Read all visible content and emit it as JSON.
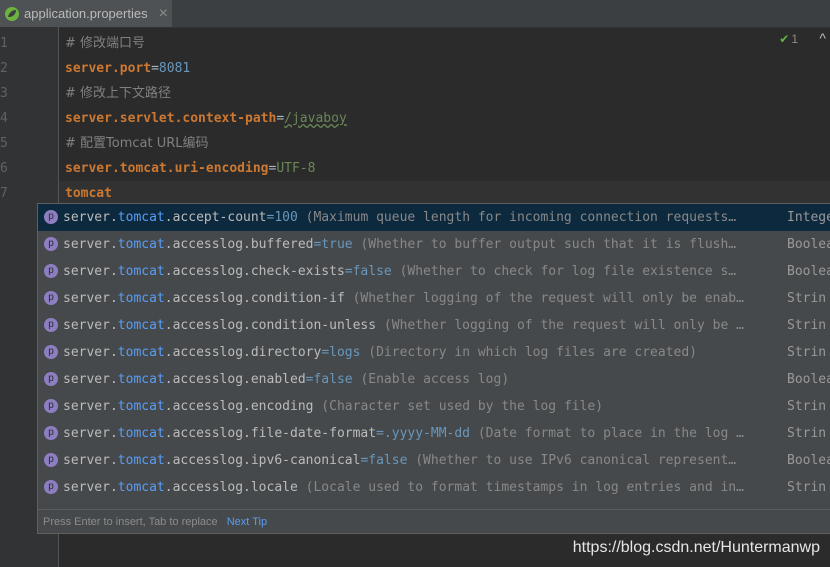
{
  "tab": {
    "label": "application.properties",
    "close": "×"
  },
  "gutter": {
    "line_numbers": [
      "1",
      "2",
      "3",
      "4",
      "5",
      "6",
      "7"
    ]
  },
  "status": {
    "check": "✔",
    "count": "1",
    "chevron": "^"
  },
  "editor": {
    "lines": [
      {
        "kind": "comment",
        "text": "# 修改端口号"
      },
      {
        "kind": "kv",
        "key": "server.port",
        "eq": "=",
        "value": "8081",
        "value_kind": "num"
      },
      {
        "kind": "comment",
        "text": "# 修改上下文路径"
      },
      {
        "kind": "kv",
        "key": "server.servlet.context-path",
        "eq": "=",
        "value": "/javaboy",
        "value_kind": "str"
      },
      {
        "kind": "comment",
        "text": "# 配置Tomcat URL编码"
      },
      {
        "kind": "kv",
        "key": "server.tomcat.uri-encoding",
        "eq": "=",
        "value": "UTF-8",
        "value_kind": "str"
      },
      {
        "kind": "key",
        "key": "tomcat"
      }
    ]
  },
  "completion": {
    "items": [
      {
        "prefix": "server.",
        "highlight": "tomcat",
        "rest": ".accept-count",
        "default": "=100",
        "desc": " (Maximum queue length for incoming connection requests…",
        "type": "Intege",
        "selected": true
      },
      {
        "prefix": "server.",
        "highlight": "tomcat",
        "rest": ".accesslog.buffered",
        "default": "=true",
        "desc": " (Whether to buffer output such that it is flush…",
        "type": "Boolea"
      },
      {
        "prefix": "server.",
        "highlight": "tomcat",
        "rest": ".accesslog.check-exists",
        "default": "=false",
        "desc": " (Whether to check for log file existence s…",
        "type": "Boolea"
      },
      {
        "prefix": "server.",
        "highlight": "tomcat",
        "rest": ".accesslog.condition-if",
        "default": "",
        "desc": " (Whether logging of the request will only be enab…",
        "type": "Strin"
      },
      {
        "prefix": "server.",
        "highlight": "tomcat",
        "rest": ".accesslog.condition-unless",
        "default": "",
        "desc": " (Whether logging of the request will only be …",
        "type": "Strin"
      },
      {
        "prefix": "server.",
        "highlight": "tomcat",
        "rest": ".accesslog.directory",
        "default": "=logs",
        "desc": " (Directory in which log files are created)",
        "type": "Strin"
      },
      {
        "prefix": "server.",
        "highlight": "tomcat",
        "rest": ".accesslog.enabled",
        "default": "=false",
        "desc": " (Enable access log)",
        "type": "Boolea"
      },
      {
        "prefix": "server.",
        "highlight": "tomcat",
        "rest": ".accesslog.encoding",
        "default": "",
        "desc": " (Character set used by the log file)",
        "type": "Strin"
      },
      {
        "prefix": "server.",
        "highlight": "tomcat",
        "rest": ".accesslog.file-date-format",
        "default": "=.yyyy-MM-dd",
        "desc": " (Date format to place in the log …",
        "type": "Strin"
      },
      {
        "prefix": "server.",
        "highlight": "tomcat",
        "rest": ".accesslog.ipv6-canonical",
        "default": "=false",
        "desc": " (Whether to use IPv6 canonical represent…",
        "type": "Boolea"
      },
      {
        "prefix": "server.",
        "highlight": "tomcat",
        "rest": ".accesslog.locale",
        "default": "",
        "desc": " (Locale used to format timestamps in log entries and in…",
        "type": "Strin"
      }
    ],
    "badge": "p",
    "footer_hint": "Press Enter to insert, Tab to replace",
    "footer_link": "Next Tip"
  },
  "watermark": "https://blog.csdn.net/Huntermanwp"
}
